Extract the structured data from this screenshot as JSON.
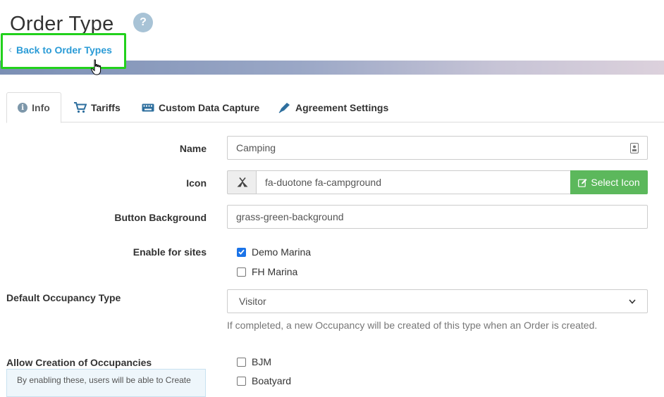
{
  "header": {
    "title": "Order Type",
    "help_symbol": "?",
    "back_link": "Back to Order Types"
  },
  "tabs": [
    {
      "label": "Info",
      "icon": "info-circle-icon",
      "active": true
    },
    {
      "label": "Tariffs",
      "icon": "shopping-cart-icon"
    },
    {
      "label": "Custom Data Capture",
      "icon": "keyboard-icon"
    },
    {
      "label": "Agreement Settings",
      "icon": "pen-nib-icon"
    }
  ],
  "form": {
    "name": {
      "label": "Name",
      "value": "Camping"
    },
    "icon": {
      "label": "Icon",
      "value": "fa-duotone fa-campground",
      "button": "Select Icon"
    },
    "button_background": {
      "label": "Button Background",
      "value": "grass-green-background"
    },
    "enable_for_sites": {
      "label": "Enable for sites",
      "options": [
        {
          "label": "Demo Marina",
          "checked": true
        },
        {
          "label": "FH Marina",
          "checked": false
        }
      ]
    },
    "default_occupancy_type": {
      "label": "Default Occupancy Type",
      "value": "Visitor",
      "help": "If completed, a new Occupancy will be created of this type when an Order is created."
    },
    "allow_creation": {
      "label": "Allow Creation of Occupancies",
      "info": "By enabling these, users will be able to Create",
      "options": [
        {
          "label": "BJM",
          "checked": false
        },
        {
          "label": "Boatyard",
          "checked": false
        }
      ]
    }
  },
  "colors": {
    "link": "#2a9bd6",
    "highlight": "#22d11c",
    "success": "#5cb85c",
    "checkbox": "#1a73e8"
  }
}
